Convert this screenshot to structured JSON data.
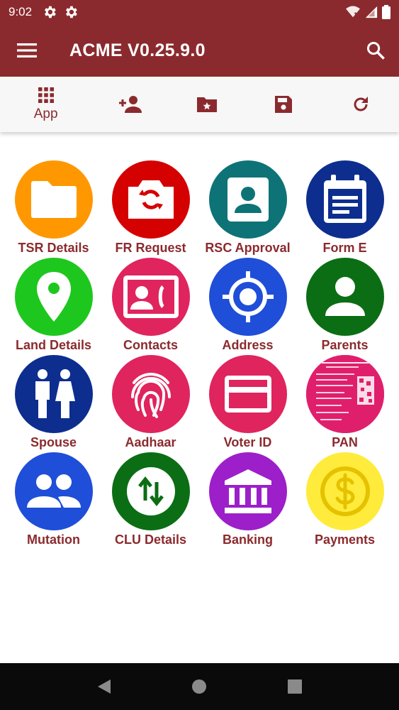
{
  "status_bar": {
    "time": "9:02"
  },
  "app_bar": {
    "title": "ACME V0.25.9.0"
  },
  "toolbar": {
    "items": [
      {
        "icon": "apps-grid-icon",
        "label": "App"
      },
      {
        "icon": "add-person-icon"
      },
      {
        "icon": "starred-folder-icon"
      },
      {
        "icon": "save-icon"
      },
      {
        "icon": "refresh-icon"
      }
    ]
  },
  "tiles": [
    {
      "label": "TSR Details",
      "color": "#ff9800",
      "icon": "folder-icon"
    },
    {
      "label": "FR Request",
      "color": "#d50000",
      "icon": "camera-switch-icon"
    },
    {
      "label": "RSC Approval",
      "color": "#0d7377",
      "icon": "contact-card-icon"
    },
    {
      "label": "Form E",
      "color": "#0d2e8f",
      "icon": "calendar-form-icon"
    },
    {
      "label": "Land Details",
      "color": "#1ec71e",
      "icon": "location-pin-icon"
    },
    {
      "label": "Contacts",
      "color": "#e0245e",
      "icon": "contact-phone-icon"
    },
    {
      "label": "Address",
      "color": "#1f4ed8",
      "icon": "crosshair-icon"
    },
    {
      "label": "Parents",
      "color": "#0b6e14",
      "icon": "person-icon"
    },
    {
      "label": "Spouse",
      "color": "#0d2e8f",
      "icon": "couple-icon"
    },
    {
      "label": "Aadhaar",
      "color": "#e0245e",
      "icon": "fingerprint-icon"
    },
    {
      "label": "Voter ID",
      "color": "#e0245e",
      "icon": "id-card-icon"
    },
    {
      "label": "PAN",
      "color": "#e01f6c",
      "icon": "pan-card-image"
    },
    {
      "label": "Mutation",
      "color": "#1f4ed8",
      "icon": "group-icon"
    },
    {
      "label": "CLU Details",
      "color": "#0b6e14",
      "icon": "swap-vertical-icon"
    },
    {
      "label": "Banking",
      "color": "#9c1fc9",
      "icon": "bank-icon"
    },
    {
      "label": "Payments",
      "color": "#ffeb3b",
      "icon": "dollar-icon"
    }
  ]
}
